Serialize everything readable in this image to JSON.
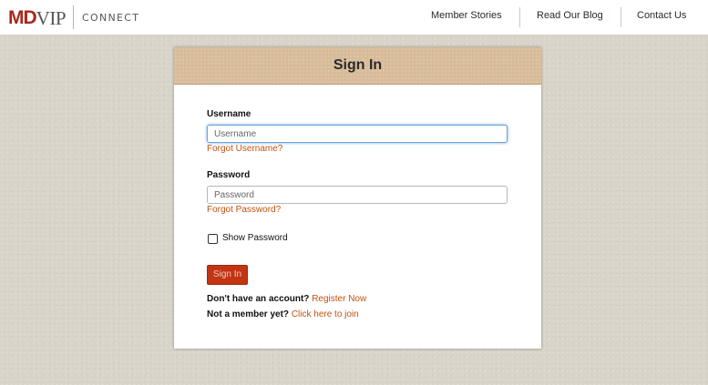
{
  "header": {
    "logo": {
      "md": "MD",
      "vip": "VIP",
      "product": "CONNECT"
    },
    "nav": [
      {
        "label": "Member Stories"
      },
      {
        "label": "Read Our Blog"
      },
      {
        "label": "Contact Us"
      }
    ]
  },
  "signin": {
    "title": "Sign In",
    "username": {
      "label": "Username",
      "placeholder": "Username",
      "value": "",
      "forgot_link": "Forgot Username?"
    },
    "password": {
      "label": "Password",
      "placeholder": "Password",
      "value": "",
      "forgot_link": "Forgot Password?"
    },
    "show_password": {
      "label": "Show Password",
      "checked": false
    },
    "submit_label": "Sign In",
    "register": {
      "question": "Don't have an account?",
      "link": "Register Now"
    },
    "join": {
      "question": "Not a member yet?",
      "link": "Click here to join"
    }
  },
  "colors": {
    "brand_red": "#a8281b",
    "link_orange": "#c4520e",
    "button_red": "#c23414",
    "card_header_tan": "#d8bc9a",
    "page_background": "#d9d4c9"
  }
}
